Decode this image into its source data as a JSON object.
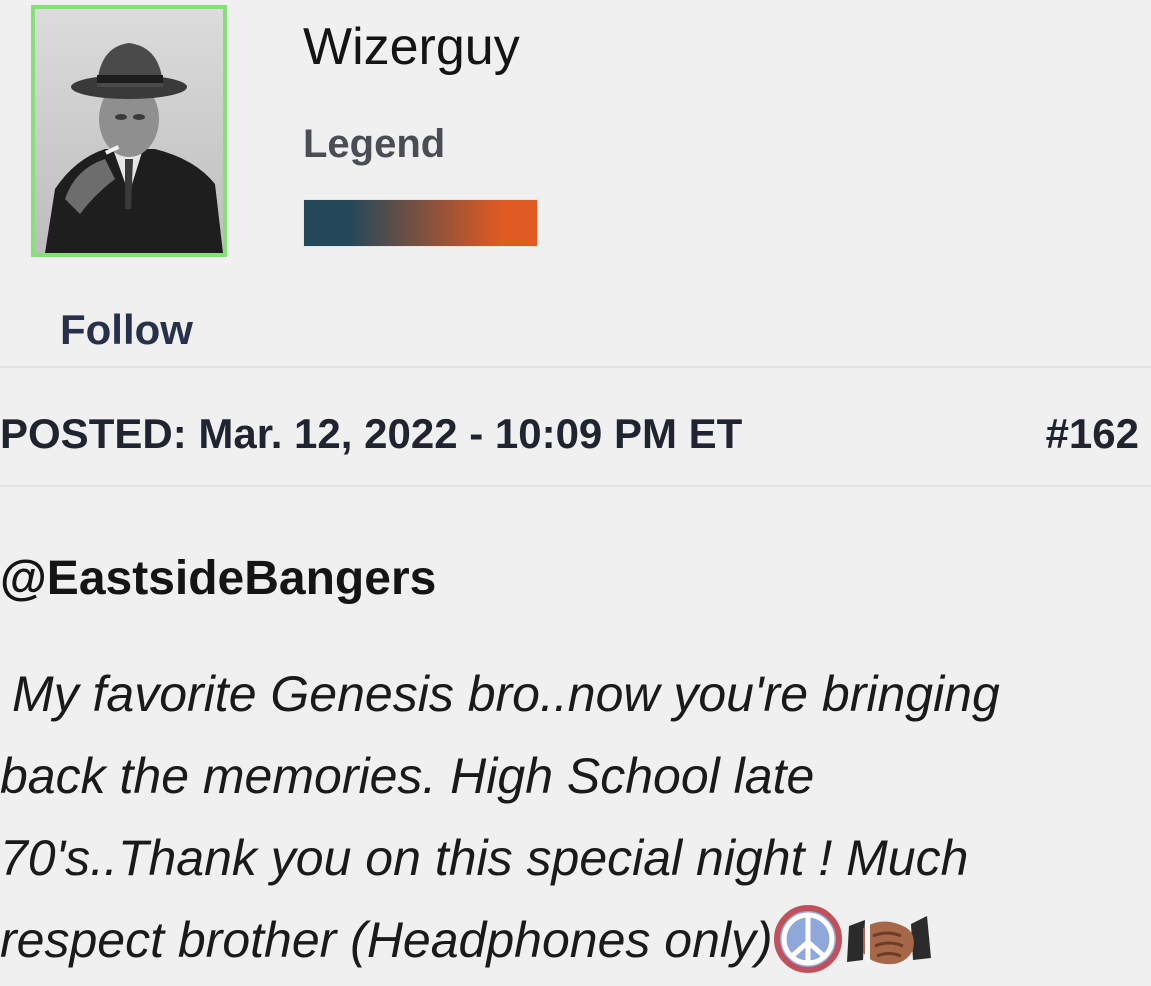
{
  "user": {
    "name": "Wizerguy",
    "rank": "Legend",
    "rank_colors": [
      "#25495a",
      "#e05a24"
    ],
    "follow_label": "Follow",
    "avatar_border_color": "#86e07a"
  },
  "post": {
    "posted": "POSTED: Mar. 12, 2022 - 10:09 PM ET",
    "number": "#162",
    "mention": "@EastsideBangers",
    "body_lines": [
      "My favorite Genesis bro..now you're bringing",
      "back the memories. High School late",
      "70's..Thank you on this special night ! Much",
      "respect brother  (Headphones only)"
    ],
    "emojis": [
      "peace-sign-icon",
      "handshake-icon"
    ]
  }
}
